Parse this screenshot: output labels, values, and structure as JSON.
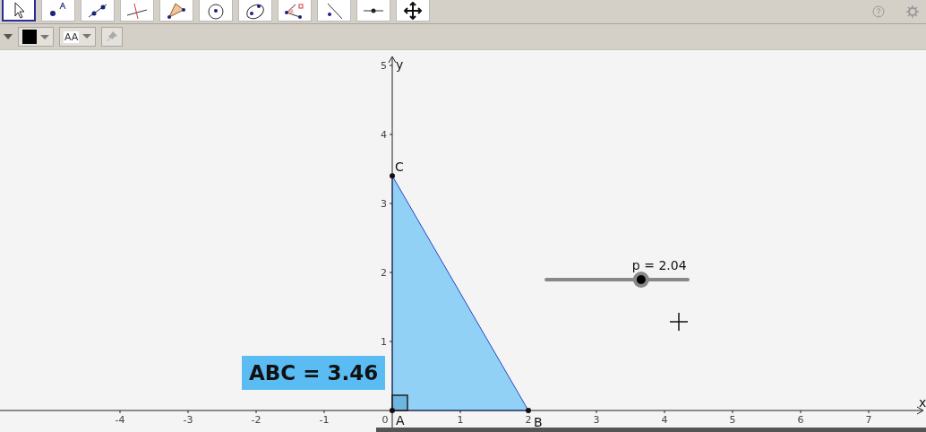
{
  "toolbar": {
    "tools": [
      {
        "kind": "move",
        "selected": true
      },
      {
        "kind": "point",
        "selected": false
      },
      {
        "kind": "line",
        "selected": false
      },
      {
        "kind": "perpendicular",
        "selected": false
      },
      {
        "kind": "polygon",
        "selected": false
      },
      {
        "kind": "circle",
        "selected": false
      },
      {
        "kind": "ellipse",
        "selected": false
      },
      {
        "kind": "angle",
        "selected": false
      },
      {
        "kind": "reflect",
        "selected": false
      },
      {
        "kind": "slider",
        "selected": false
      },
      {
        "kind": "move-view",
        "selected": false
      }
    ]
  },
  "style_bar": {
    "text_style": "AA"
  },
  "graphics": {
    "x_axis": {
      "label": "x",
      "ticks": [
        "-4",
        "-3",
        "-2",
        "-1",
        "0",
        "1",
        "2",
        "3",
        "4",
        "5",
        "6",
        "7"
      ]
    },
    "y_axis": {
      "label": "y",
      "ticks": [
        "5",
        "4",
        "3",
        "2",
        "1"
      ]
    },
    "points": [
      {
        "name": "A"
      },
      {
        "name": "B"
      },
      {
        "name": "C"
      }
    ],
    "area_label": "ABC = 3.46",
    "slider": {
      "label": "p = 2.04",
      "level": 0.67
    }
  }
}
